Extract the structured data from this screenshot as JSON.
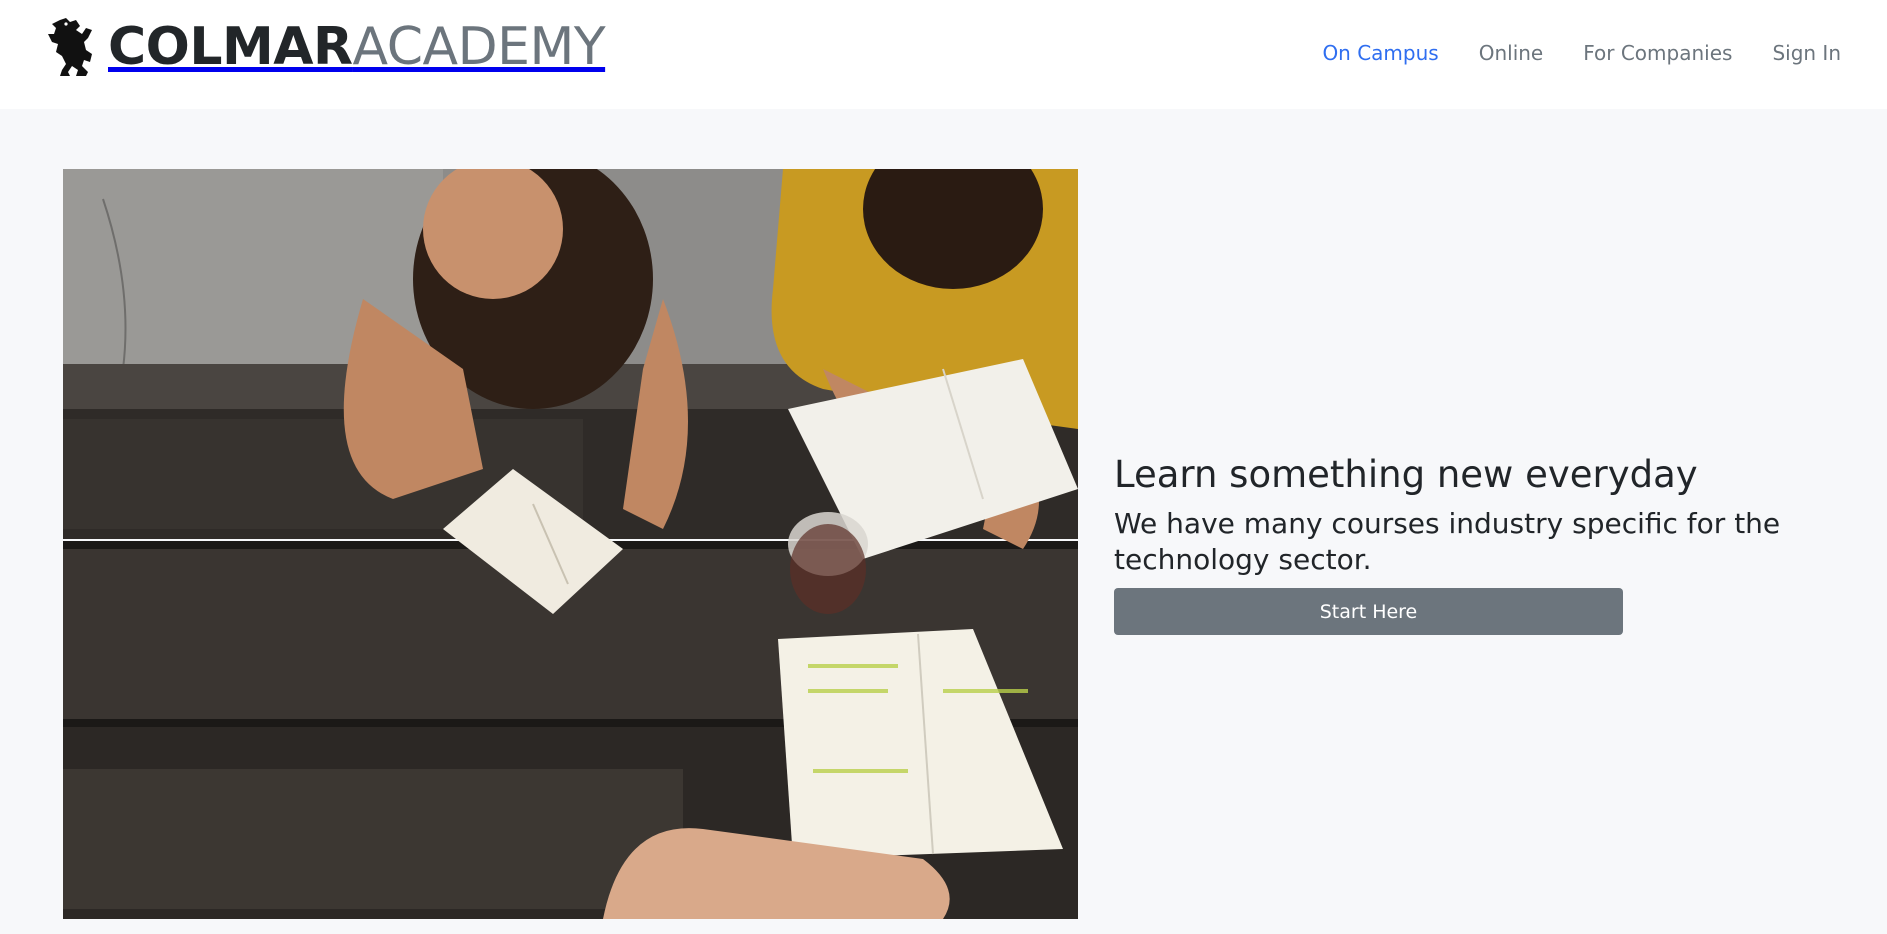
{
  "brand": {
    "name_bold": "COLMAR",
    "name_light": "ACADEMY",
    "logo_icon": "lion-rampant-icon"
  },
  "nav": {
    "items": [
      {
        "label": "On Campus",
        "active": true
      },
      {
        "label": "Online",
        "active": false
      },
      {
        "label": "For Companies",
        "active": false
      },
      {
        "label": "Sign In",
        "active": false
      }
    ]
  },
  "hero": {
    "image_subject": "students-reading-at-picnic-table",
    "heading": "Learn something new everyday",
    "subheading": "We have many courses industry specific for the technology sector.",
    "cta_label": "Start Here"
  },
  "colors": {
    "accent": "#2f6ef0",
    "nav_text": "#6c757d",
    "button_bg": "#6c757d",
    "page_bg": "#f7f8fa"
  }
}
